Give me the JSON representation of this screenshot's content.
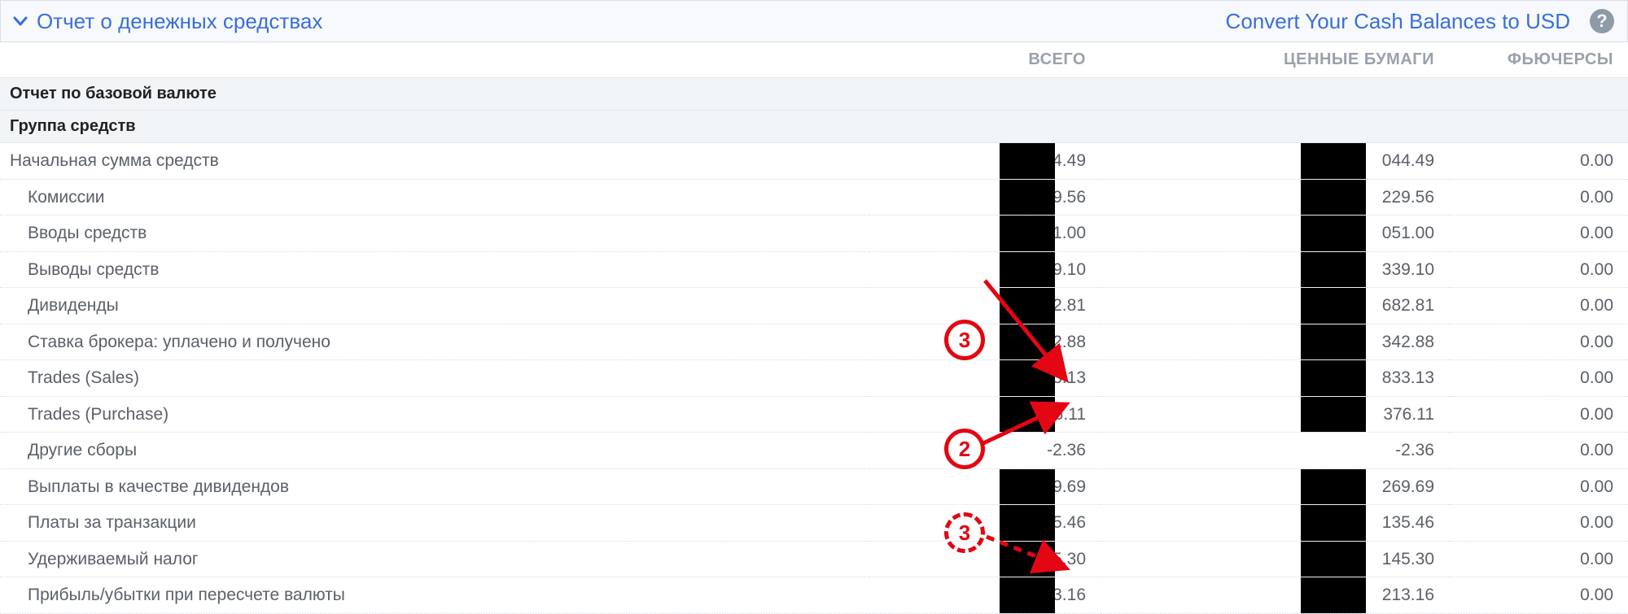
{
  "header": {
    "title": "Отчет о денежных средствах",
    "convert_link": "Convert Your Cash Balances to USD"
  },
  "columns": {
    "label": "",
    "total": "ВСЕГО",
    "securities": "ЦЕННЫЕ БУМАГИ",
    "futures": "ФЬЮЧЕРСЫ"
  },
  "sections": {
    "base_currency": "Отчет по базовой валюте",
    "funds_group": "Группа средств"
  },
  "rows": [
    {
      "label": "Начальная сумма средств",
      "indent": false,
      "total": "044.49",
      "sec": "044.49",
      "fut": "0.00"
    },
    {
      "label": "Комиссии",
      "indent": true,
      "total": "229.56",
      "sec": "229.56",
      "fut": "0.00"
    },
    {
      "label": "Вводы средств",
      "indent": true,
      "total": "051.00",
      "sec": "051.00",
      "fut": "0.00"
    },
    {
      "label": "Выводы средств",
      "indent": true,
      "total": "339.10",
      "sec": "339.10",
      "fut": "0.00"
    },
    {
      "label": "Дивиденды",
      "indent": true,
      "total": "682.81",
      "sec": "682.81",
      "fut": "0.00"
    },
    {
      "label": "Ставка брокера: уплачено и получено",
      "indent": true,
      "total": "342.88",
      "sec": "342.88",
      "fut": "0.00"
    },
    {
      "label": "Trades (Sales)",
      "indent": true,
      "total": "833.13",
      "sec": "833.13",
      "fut": "0.00"
    },
    {
      "label": "Trades (Purchase)",
      "indent": true,
      "total": "376.11",
      "sec": "376.11",
      "fut": "0.00"
    },
    {
      "label": "Другие сборы",
      "indent": true,
      "total": "-2.36",
      "sec": "-2.36",
      "fut": "0.00",
      "noredact": true
    },
    {
      "label": "Выплаты в качестве дивидендов",
      "indent": true,
      "total": "269.69",
      "sec": "269.69",
      "fut": "0.00"
    },
    {
      "label": "Платы за транзакции",
      "indent": true,
      "total": "135.46",
      "sec": "135.46",
      "fut": "0.00"
    },
    {
      "label": "Удерживаемый налог",
      "indent": true,
      "total": "145.30",
      "sec": "145.30",
      "fut": "0.00"
    },
    {
      "label": "Прибыль/убытки при пересчете валюты",
      "indent": true,
      "total": "213.16",
      "sec": "213.16",
      "fut": "0.00"
    }
  ],
  "annotations": {
    "c3a": "3",
    "c2": "2",
    "c3b": "3"
  }
}
